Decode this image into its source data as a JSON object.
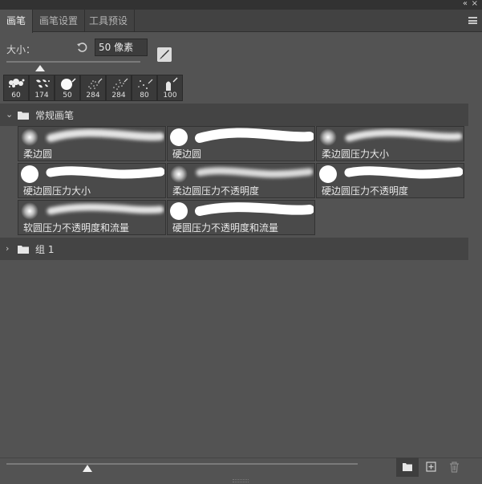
{
  "tabs": [
    {
      "label": "画笔",
      "active": true
    },
    {
      "label": "画笔设置",
      "active": false
    },
    {
      "label": "工具预设",
      "active": false
    }
  ],
  "window": {
    "collapse_glyph": "«",
    "close_glyph": "×"
  },
  "size": {
    "label": "大小：",
    "value": "50 像素",
    "slider_fraction": 0.25
  },
  "recent_brushes": [
    {
      "size": "60",
      "kind": "splatter"
    },
    {
      "size": "174",
      "kind": "scatter-leaves"
    },
    {
      "size": "50",
      "kind": "hard-round"
    },
    {
      "size": "284",
      "kind": "spray"
    },
    {
      "size": "284",
      "kind": "spray"
    },
    {
      "size": "80",
      "kind": "sparse-dots"
    },
    {
      "size": "100",
      "kind": "bristle"
    }
  ],
  "groups": [
    {
      "name": "常规画笔",
      "expanded": true
    },
    {
      "name": "组 1",
      "expanded": false
    }
  ],
  "brushes": [
    {
      "name": "柔边圆",
      "tip": "soft"
    },
    {
      "name": "硬边圆",
      "tip": "hard"
    },
    {
      "name": "柔边圆压力大小",
      "tip": "soft"
    },
    {
      "name": "硬边圆压力大小",
      "tip": "hard"
    },
    {
      "name": "柔边圆压力不透明度",
      "tip": "soft"
    },
    {
      "name": "硬边圆压力不透明度",
      "tip": "hard"
    },
    {
      "name": "软圆压力不透明度和流量",
      "tip": "soft"
    },
    {
      "name": "硬圆压力不透明度和流量",
      "tip": "hard"
    }
  ],
  "preview_slider_fraction": 0.23,
  "bottom_icons": [
    "new-group-icon",
    "new-brush-icon",
    "trash-icon"
  ],
  "colors": {
    "panel_bg": "#535353",
    "tab_bar": "#424242",
    "header_bg": "#444444",
    "cell_bg": "#4a4a4a"
  }
}
